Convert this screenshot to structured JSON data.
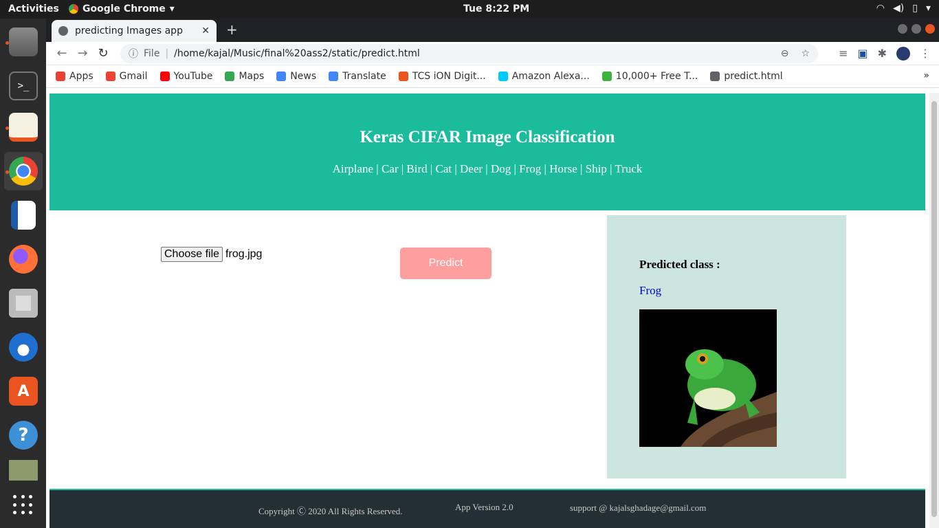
{
  "topbar": {
    "activities": "Activities",
    "app_menu": "Google Chrome",
    "clock": "Tue  8:22 PM"
  },
  "browser": {
    "tab_title": "predicting Images app",
    "url_scheme": "File",
    "url": "/home/kajal/Music/final%20ass2/static/predict.html",
    "bookmarks": [
      {
        "label": "Apps",
        "color": "#e94235"
      },
      {
        "label": "Gmail",
        "color": "#ea4335"
      },
      {
        "label": "YouTube",
        "color": "#ff0000"
      },
      {
        "label": "Maps",
        "color": "#34a853"
      },
      {
        "label": "News",
        "color": "#4285f4"
      },
      {
        "label": "Translate",
        "color": "#4285f4"
      },
      {
        "label": "TCS iON Digit...",
        "color": "#e95420"
      },
      {
        "label": "Amazon Alexa...",
        "color": "#00caff"
      },
      {
        "label": "10,000+ Free T...",
        "color": "#3eb33e"
      },
      {
        "label": "predict.html",
        "color": "#5f6368"
      }
    ]
  },
  "page": {
    "title": "Keras CIFAR Image Classification",
    "classes": "Airplane | Car | Bird | Cat | Deer | Dog | Frog | Horse | Ship | Truck",
    "choose_file_label": "Choose file",
    "chosen_file": "frog.jpg",
    "predict_label": "Predict",
    "predicted_label": "Predicted class :",
    "predicted_value": "Frog",
    "footer_copyright": "Copyright Ⓒ 2020 All Rights Reserved.",
    "footer_version": "App Version 2.0",
    "footer_support": "support @ kajalsghadage@gmail.com"
  },
  "colors": {
    "hero": "#1abc9c",
    "result_bg": "#cce6df",
    "predict_button": "#ff9e9e",
    "footer": "#242f35"
  }
}
